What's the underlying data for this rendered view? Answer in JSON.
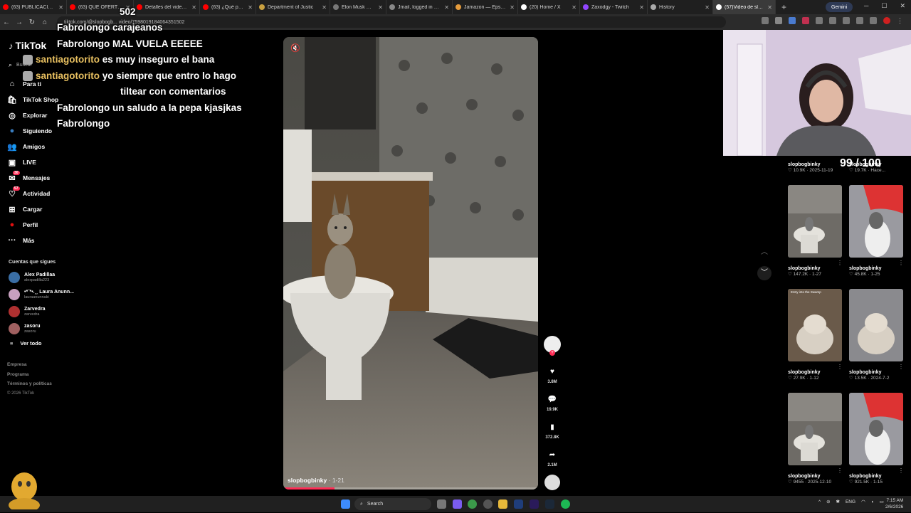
{
  "browser": {
    "tabs": [
      {
        "title": "(63) PUBLICACIONES",
        "color": "#ff0000"
      },
      {
        "title": "(63) QUE OFERTON",
        "color": "#ff0000"
      },
      {
        "title": "Detalles del video - Y",
        "color": "#ff0000"
      },
      {
        "title": "(63) ¿Qué pasó con",
        "color": "#ff0000"
      },
      {
        "title": "Department of Justic",
        "color": "#c8a040"
      },
      {
        "title": "Elon Musk — Epstein",
        "color": "#777777"
      },
      {
        "title": "Jmail, logged in as je",
        "color": "#888888"
      },
      {
        "title": "Jamazon — Epstein A",
        "color": "#e49b3c"
      },
      {
        "title": "(20) Home / X",
        "color": "#ffffff"
      },
      {
        "title": "Zaxodgy - Twitch",
        "color": "#9146ff"
      },
      {
        "title": "History",
        "color": "#aaaaaa"
      },
      {
        "title": "(57)Video de slopbo",
        "color": "#ffffff"
      }
    ],
    "gemini_label": "Gemini",
    "url": "tiktok.com/@slopbogb... video/7598019184064351502"
  },
  "sidebar": {
    "logo": "TikTok",
    "search_placeholder": "Buscar",
    "nav": [
      {
        "label": "Para ti",
        "icon": "home-icon"
      },
      {
        "label": "TikTok Shop",
        "icon": "shop-icon"
      },
      {
        "label": "Explorar",
        "icon": "compass-icon"
      },
      {
        "label": "Siguiendo",
        "icon": "following-icon"
      },
      {
        "label": "Amigos",
        "icon": "friends-icon"
      },
      {
        "label": "LIVE",
        "icon": "live-icon"
      },
      {
        "label": "Mensajes",
        "icon": "messages-icon",
        "badge": "30"
      },
      {
        "label": "Actividad",
        "icon": "activity-icon",
        "badge": "57"
      },
      {
        "label": "Cargar",
        "icon": "upload-icon"
      },
      {
        "label": "Perfil",
        "icon": "profile-icon"
      },
      {
        "label": "Más",
        "icon": "more-icon"
      }
    ],
    "following_title": "Cuentas que sigues",
    "following": [
      {
        "name": "Alex Padillaa",
        "handle": "alexpadilla223",
        "color": "#3a6ea5"
      },
      {
        "name": "•*¨*•.¸¸ Laura Anunn...",
        "handle": "lauraanunnaki",
        "color": "#c8a0c0"
      },
      {
        "name": "Zarvedra",
        "handle": "zarvedra",
        "color": "#b03030"
      },
      {
        "name": "zasoru",
        "handle": "zasoru",
        "color": "#a06060"
      }
    ],
    "ver_todo": "Ver todo",
    "footer": [
      "Empresa",
      "Programa",
      "Términos y políticas",
      "© 2026 TikTok"
    ]
  },
  "chat": {
    "top_fragment": "502",
    "lines": [
      {
        "user": "Fabrolongo",
        "msg": "carajeanos",
        "gold": false,
        "bot": false
      },
      {
        "user": "Fabrolongo",
        "msg": "MAL VUELA EEEEE",
        "gold": false,
        "bot": false
      },
      {
        "user": "santiagotorito",
        "msg": "es muy inseguro el bana",
        "gold": true,
        "bot": true
      },
      {
        "user": "santiagotorito",
        "msg": "yo siempre que entro lo hago",
        "gold": true,
        "bot": true
      },
      {
        "user": "",
        "msg": "tiltear con comentarios",
        "gold": false,
        "bot": false
      },
      {
        "user": "Fabrolongo",
        "msg": "un saludo a la pepa kjasjkas",
        "gold": false,
        "bot": false
      },
      {
        "user": "Fabrolongo",
        "msg": "",
        "gold": false,
        "bot": false
      }
    ]
  },
  "video": {
    "author": "slopbogbinky",
    "date": "· 1-21",
    "progress": 0.2,
    "likes": "3.8M",
    "comments": "19.9K",
    "saves": "372.8K",
    "shares": "2.1M"
  },
  "overlay": {
    "score": "99 / 100"
  },
  "grid": [
    {
      "author": "slopbogbinky",
      "likes": "10.9K",
      "date": "2025-11-19",
      "thumb": "none"
    },
    {
      "author": "slopbogbinky",
      "likes": "19.7K",
      "date": "Hace...",
      "thumb": "none"
    },
    {
      "author": "slopbogbinky",
      "likes": "147.2K",
      "date": "1-27",
      "thumb": "toilet"
    },
    {
      "author": "slopbogbinky",
      "likes": "45.8K",
      "date": "1-25",
      "thumb": "red"
    },
    {
      "author": "slopbogbinky",
      "likes": "27.9K",
      "date": "1-12",
      "thumb": "hippo",
      "caption": "Entry into the Swamp"
    },
    {
      "author": "slopbogbinky",
      "likes": "13.5K",
      "date": "2024-7-2",
      "thumb": "hippo2"
    },
    {
      "author": "slopbogbinky",
      "likes": "9455",
      "date": "2025-12-10",
      "thumb": "toilet"
    },
    {
      "author": "slopbogbinky",
      "likes": "921.5K",
      "date": "1-15",
      "thumb": "red"
    }
  ],
  "taskbar": {
    "search": "Search",
    "lang": "ENG",
    "time": "7:15 AM",
    "date": "2/6/2026"
  },
  "colors": {
    "accent": "#fe2c55",
    "gold": "#e8c060"
  }
}
